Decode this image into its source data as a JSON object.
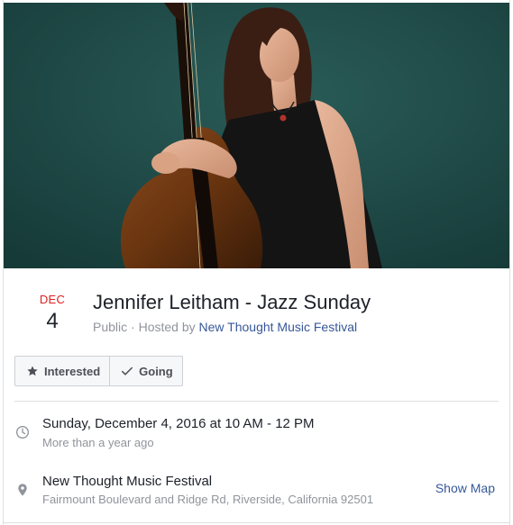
{
  "event": {
    "month": "DEC",
    "day": "4",
    "title": "Jennifer Leitham - Jazz Sunday",
    "visibility": "Public",
    "hosted_prefix": " · Hosted by ",
    "host": "New Thought Music Festival",
    "cover_image": "woman-with-upright-bass-photo"
  },
  "actions": {
    "interested_label": "Interested",
    "interested_icon": "star-icon",
    "going_label": "Going",
    "going_icon": "checkmark-icon"
  },
  "details": {
    "datetime": "Sunday, December 4, 2016 at 10 AM - 12 PM",
    "relative_time": "More than a year ago",
    "time_icon": "clock-icon",
    "venue": "New Thought Music Festival",
    "address": "Fairmount Boulevard and Ridge Rd, Riverside, California 92501",
    "location_icon": "map-pin-icon",
    "show_map_label": "Show Map"
  },
  "colors": {
    "month_red": "#e02020",
    "link_blue": "#365899",
    "muted_gray": "#90949c",
    "cover_bg": "#1f4a47"
  }
}
